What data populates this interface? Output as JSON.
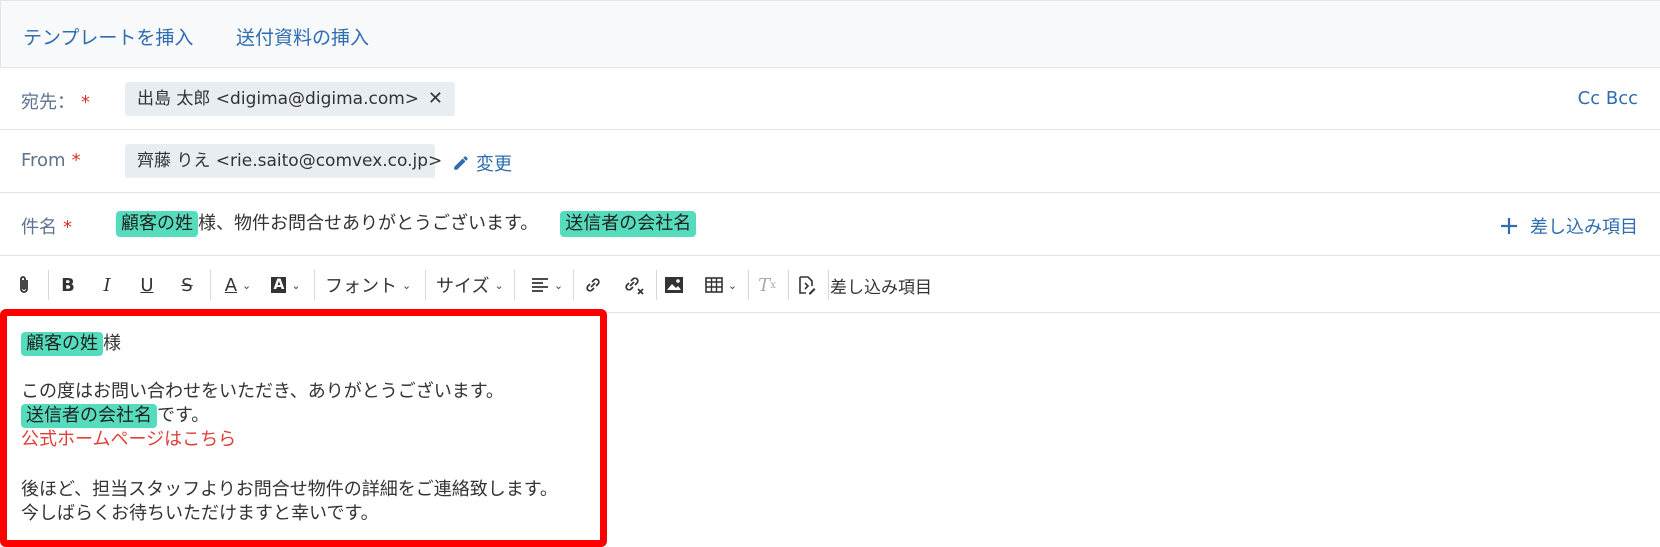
{
  "top_links": {
    "insert_template": "テンプレートを挿入",
    "insert_attachment": "送付資料の挿入"
  },
  "to": {
    "label": "宛先：",
    "required_mark": "*",
    "recipient": "出島 太郎 <digima@digima.com>",
    "remove_icon": "✕",
    "cc_bcc": "Cc Bcc"
  },
  "from": {
    "label": "From",
    "required_mark": "*",
    "sender": "齊藤 りえ <rie.saito@comvex.co.jp>",
    "change_label": "変更"
  },
  "subject": {
    "label": "件名",
    "required_mark": "*",
    "tag_customer": "顧客の姓",
    "text": "様、物件お問合せありがとうございます。",
    "tag_company": "送信者の会社名",
    "merge_button": "差し込み項目"
  },
  "toolbar": {
    "font": "フォント",
    "size": "サイズ",
    "merge_field": "差し込み項目"
  },
  "body": {
    "tag_customer": "顧客の姓",
    "honorific": "様",
    "line1": "この度はお問い合わせをいただき、ありがとうございます。",
    "tag_company": "送信者の会社名",
    "desu": "です。",
    "homepage_link": "公式ホームページはこちら",
    "line4": "後ほど、担当スタッフよりお問合せ物件の詳細をご連絡致します。",
    "line5": "今しばらくお待ちいただけますと幸いです。"
  },
  "colors": {
    "link": "#2f6db0",
    "tag": "#55dcbc",
    "required": "#d9302c",
    "highlight_border": "#ff0000",
    "homepage_link": "#e0403a"
  },
  "icons": [
    "paperclip-icon",
    "bold-icon",
    "italic-icon",
    "underline-icon",
    "strikethrough-icon",
    "text-color-icon",
    "background-color-icon",
    "align-icon",
    "link-icon",
    "unlink-icon",
    "image-icon",
    "table-icon",
    "clear-format-icon",
    "merge-field-icon",
    "pencil-icon",
    "plus-icon",
    "close-icon"
  ]
}
